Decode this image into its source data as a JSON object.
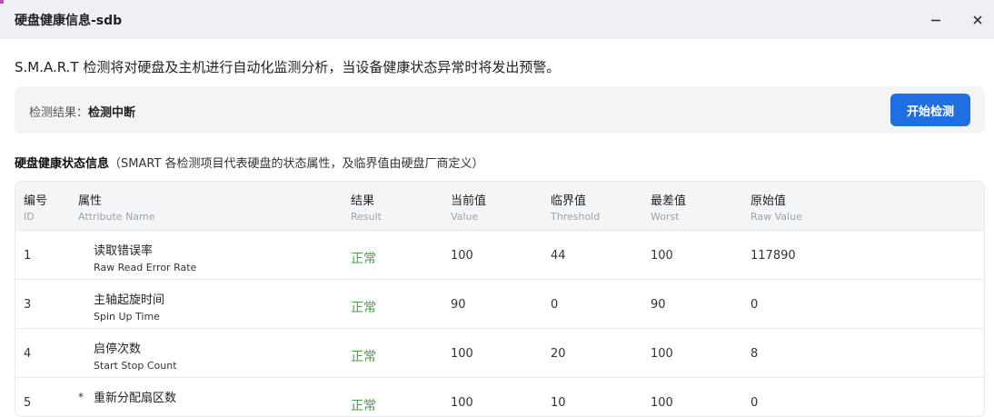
{
  "window": {
    "title": "硬盘健康信息-sdb",
    "minimize_icon": "minimize-icon",
    "close_icon": "close-icon"
  },
  "description": "S.M.A.R.T 检测将对硬盘及主机进行自动化监测分析，当设备健康状态异常时将发出预警。",
  "result": {
    "label": "检测结果：",
    "value": "检测中断",
    "button_label": "开始检测"
  },
  "section": {
    "title": "硬盘健康状态信息",
    "subtitle": "（SMART 各检测项目代表硬盘的状态属性，及临界值由硬盘厂商定义）"
  },
  "table": {
    "columns": [
      {
        "zh": "编号",
        "en": "ID"
      },
      {
        "zh": "属性",
        "en": "Attribute Name"
      },
      {
        "zh": "结果",
        "en": "Result"
      },
      {
        "zh": "当前值",
        "en": "Value"
      },
      {
        "zh": "临界值",
        "en": "Threshold"
      },
      {
        "zh": "最差值",
        "en": "Worst"
      },
      {
        "zh": "原始值",
        "en": "Raw Value"
      }
    ],
    "rows": [
      {
        "id": "1",
        "star": "",
        "name_zh": "读取错误率",
        "name_en": "Raw Read Error Rate",
        "result": "正常",
        "value": "100",
        "threshold": "44",
        "worst": "100",
        "raw": "117890"
      },
      {
        "id": "3",
        "star": "",
        "name_zh": "主轴起旋时间",
        "name_en": "Spin Up Time",
        "result": "正常",
        "value": "90",
        "threshold": "0",
        "worst": "90",
        "raw": "0"
      },
      {
        "id": "4",
        "star": "",
        "name_zh": "启停次数",
        "name_en": "Start Stop Count",
        "result": "正常",
        "value": "100",
        "threshold": "20",
        "worst": "100",
        "raw": "8"
      },
      {
        "id": "5",
        "star": "*",
        "name_zh": "重新分配扇区数",
        "name_en": "",
        "result": "正常",
        "value": "100",
        "threshold": "10",
        "worst": "100",
        "raw": "0"
      }
    ]
  },
  "colors": {
    "accent": "#1f6fe0",
    "ok": "#3fa33f",
    "titlebar": "#eef0f5"
  }
}
